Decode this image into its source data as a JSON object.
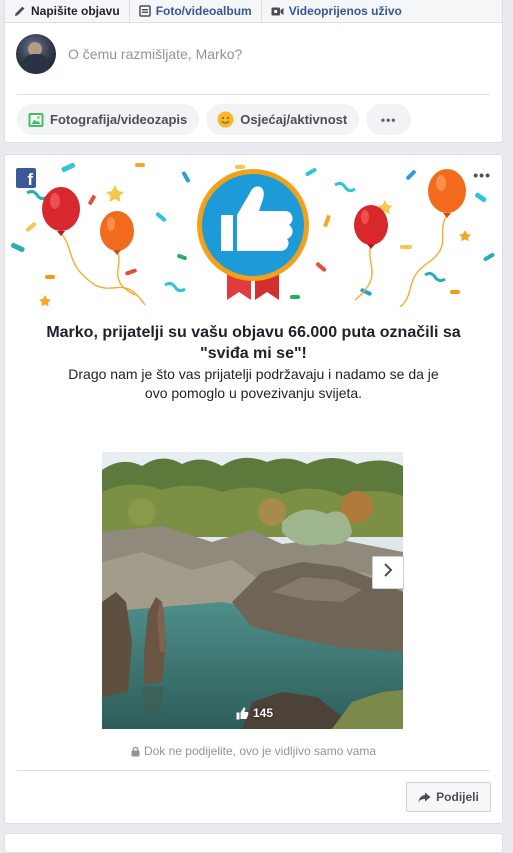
{
  "composer": {
    "tabs": [
      {
        "label": "Napišite objavu",
        "icon": "pencil-icon"
      },
      {
        "label": "Foto/videoalbum",
        "icon": "photo-album-icon"
      },
      {
        "label": "Videoprijenos uživo",
        "icon": "video-camera-icon"
      }
    ],
    "placeholder": "O čemu razmišljate, Marko?",
    "buttons": [
      {
        "label": "Fotografija/videozapis",
        "icon": "photo-icon"
      },
      {
        "label": "Osjećaj/aktivnost",
        "icon": "smiley-icon"
      },
      {
        "label": "•••",
        "icon": "more-dots-icon"
      }
    ]
  },
  "card": {
    "brand_icon": "facebook-logo",
    "more_label": "•••",
    "headline": "Marko, prijatelji su vašu objavu 66.000 puta označili sa \"sviđa mi se\"!",
    "subtext": "Drago nam je što vas prijatelji podržavaju i nadamo se da je ovo pomoglo u povezivanju svijeta.",
    "photo": {
      "like_count": "145",
      "next_icon": "chevron-right-icon"
    },
    "privacy_note": "Dok ne podijelite, ovo je vidljivo samo vama",
    "share_label": "Podijeli"
  },
  "colors": {
    "brand_blue": "#3b5998",
    "link_blue": "#365899",
    "page_bg": "#e9ebee",
    "badge_gold": "#f4a11a",
    "badge_blue": "#1d9bd8",
    "ribbon_red": "#e23b3b"
  }
}
